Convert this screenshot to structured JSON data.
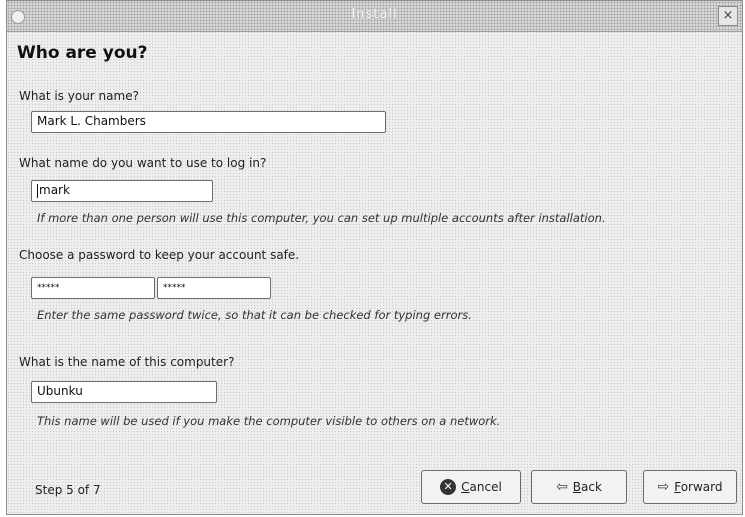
{
  "window": {
    "title": "Install",
    "close_label": "×"
  },
  "page": {
    "heading": "Who are you?"
  },
  "name_section": {
    "label": "What is your name?",
    "value": "Mark L. Chambers"
  },
  "login_section": {
    "label": "What name do you want to use to log in?",
    "value": "mark",
    "hint": "If more than one person will use this computer, you can set up multiple accounts after installation."
  },
  "password_section": {
    "label": "Choose a password to keep your account safe.",
    "password_mask": "*****",
    "confirm_mask": "*****",
    "hint": "Enter the same password twice, so that it can be checked for typing errors."
  },
  "computer_section": {
    "label": "What is the name of this computer?",
    "value": "Ubunku",
    "hint": "This name will be used if you make the computer visible to others on a network."
  },
  "footer": {
    "step_text": "Step 5 of 7",
    "cancel_label": "Cancel",
    "back_label": "Back",
    "forward_label": "Forward"
  },
  "icons": {
    "cancel": "cancel-icon",
    "back": "back-arrow-icon",
    "forward": "forward-arrow-icon",
    "close": "close-icon"
  }
}
